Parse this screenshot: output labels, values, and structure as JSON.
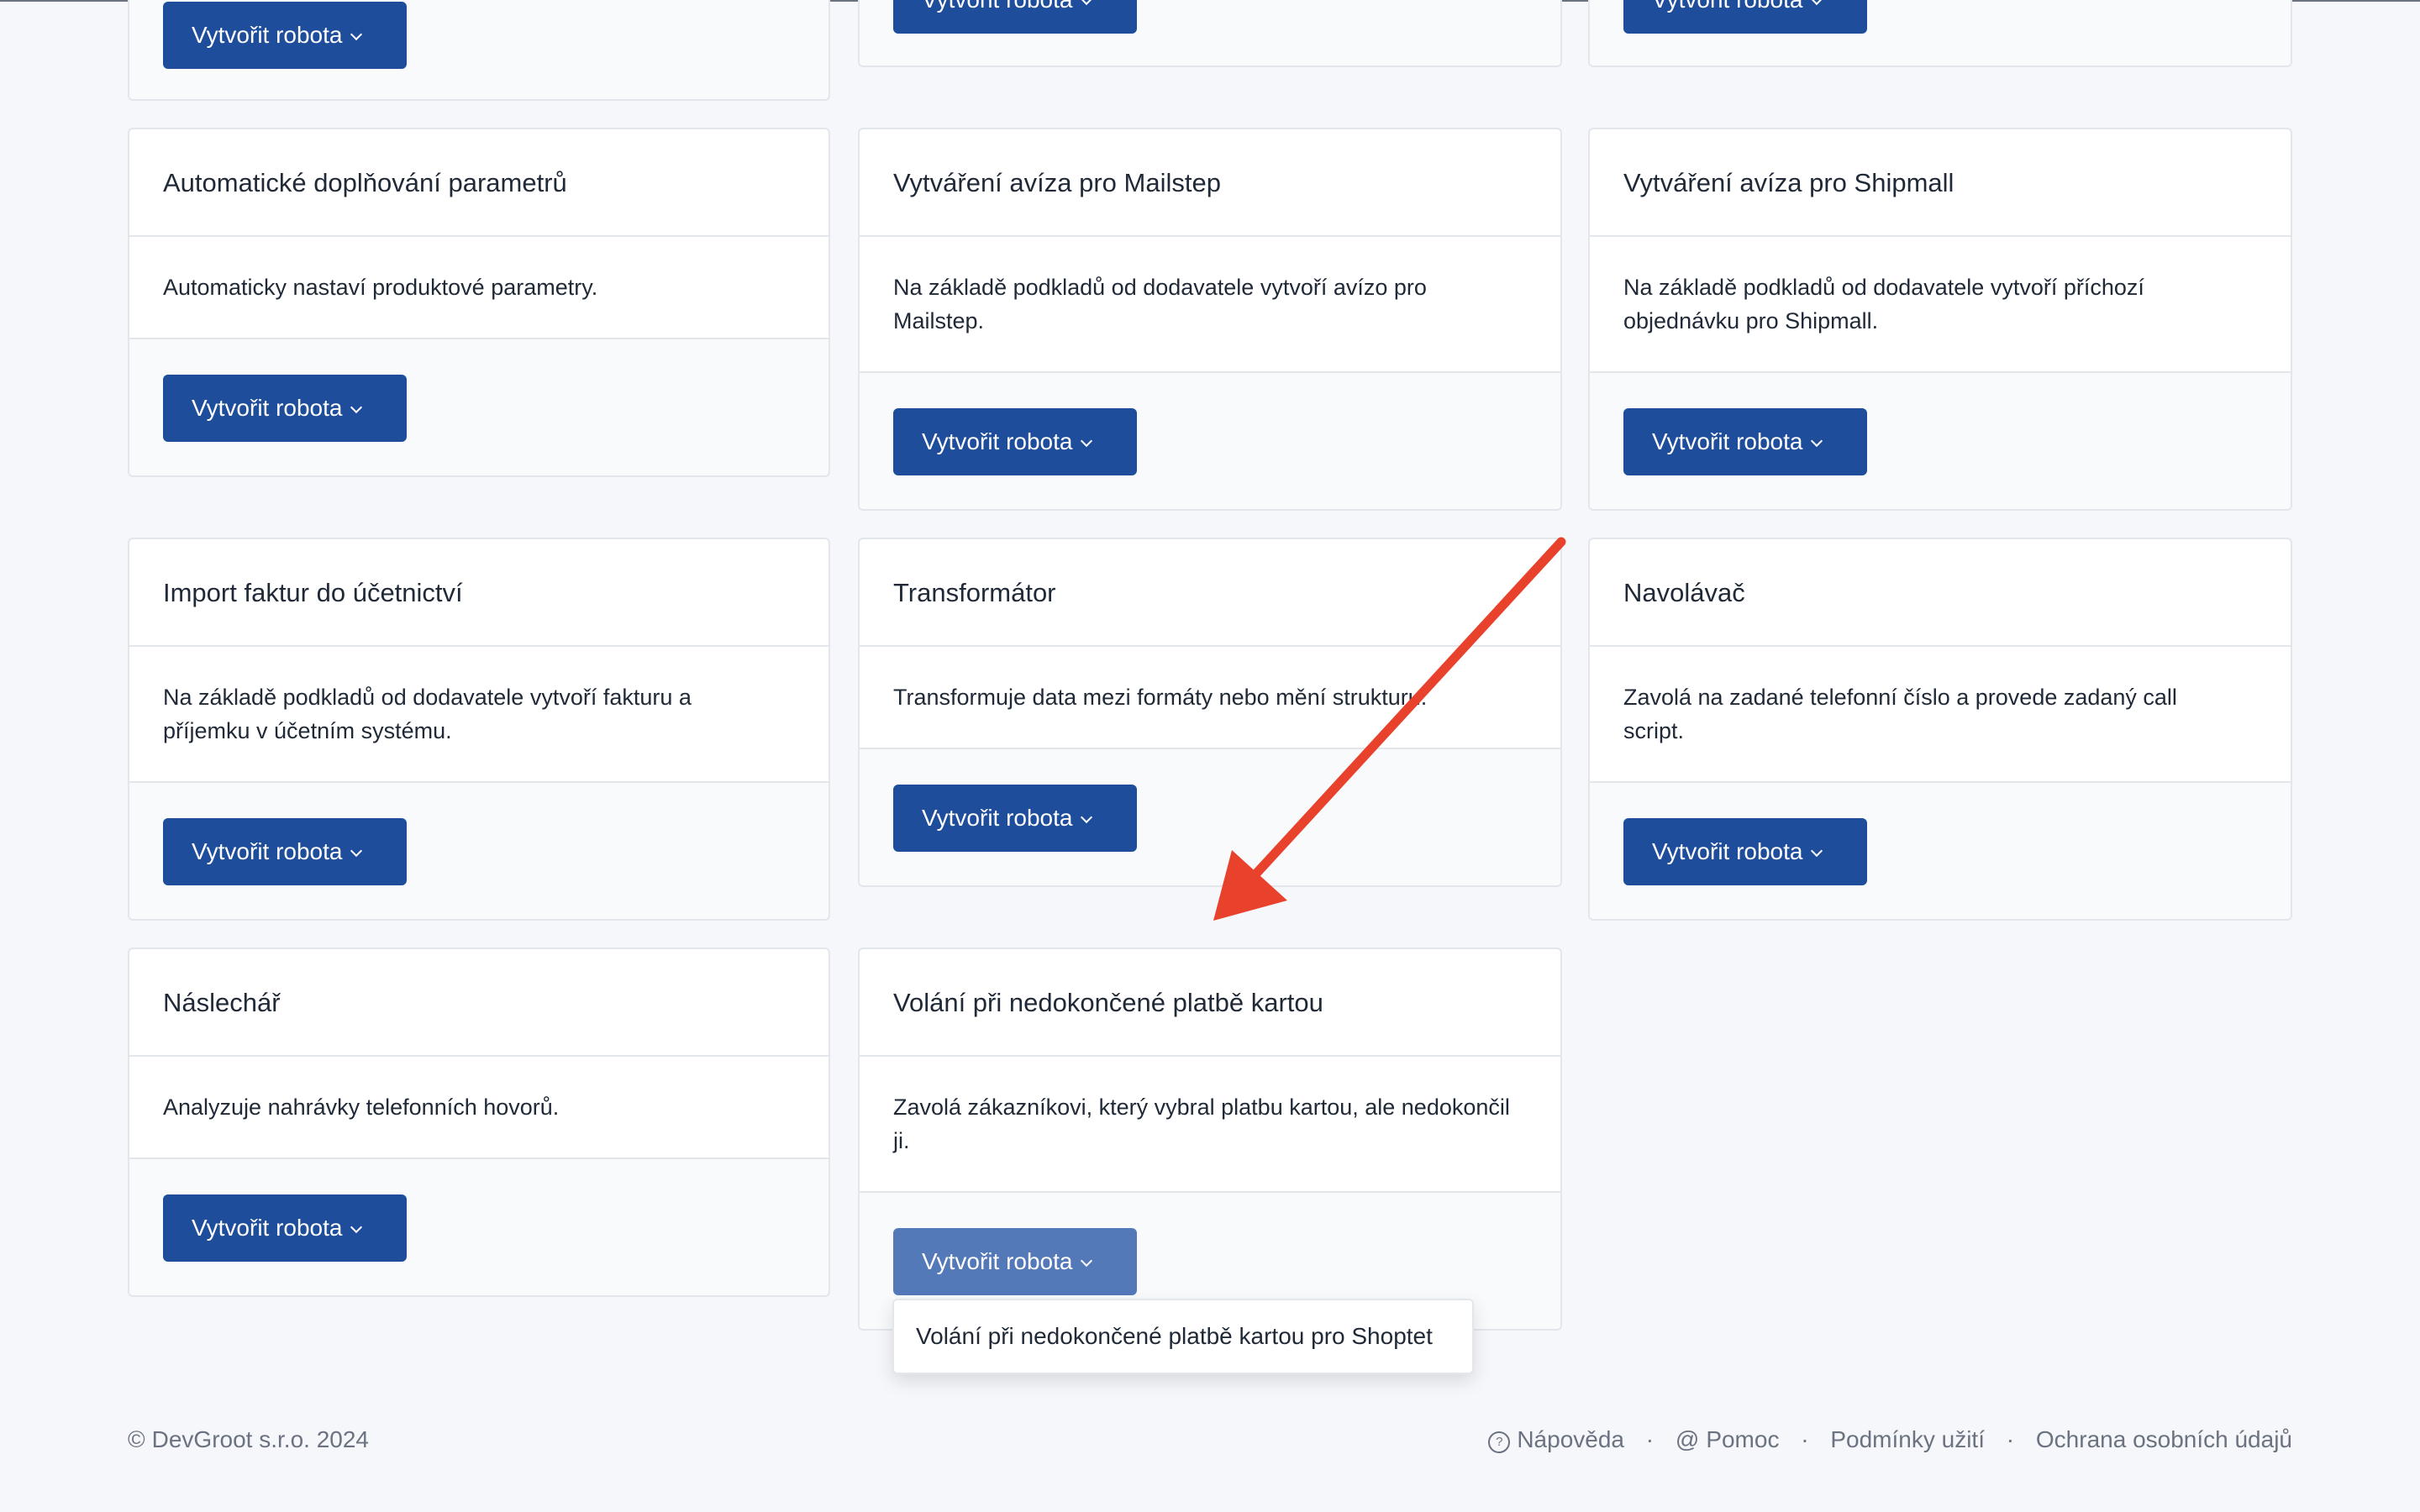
{
  "button_label": "Vytvořit robota",
  "cards": [
    {
      "title": "",
      "description": ""
    },
    {
      "title": "",
      "description": ""
    },
    {
      "title": "",
      "description": ""
    },
    {
      "title": "Automatické doplňování parametrů",
      "description": "Automaticky nastaví produktové parametry."
    },
    {
      "title": "Vytváření avíza pro Mailstep",
      "description": "Na základě podkladů od dodavatele vytvoří avízo pro Mailstep."
    },
    {
      "title": "Vytváření avíza pro Shipmall",
      "description": "Na základě podkladů od dodavatele vytvoří příchozí objednávku pro Shipmall."
    },
    {
      "title": "Import faktur do účetnictví",
      "description": "Na základě podkladů od dodavatele vytvoří fakturu a příjemku v účetním systému."
    },
    {
      "title": "Transformátor",
      "description": "Transformuje data mezi formáty nebo mění strukturu."
    },
    {
      "title": "Navolávač",
      "description": "Zavolá na zadané telefonní číslo a provede zadaný call script."
    },
    {
      "title": "Náslechář",
      "description": "Analyzuje nahrávky telefonních hovorů."
    },
    {
      "title": "Volání při nedokončené platbě kartou",
      "description": "Zavolá zákazníkovi, který vybral platbu kartou, ale nedokončil ji."
    }
  ],
  "dropdown": {
    "items": [
      "Volání při nedokončené platbě kartou pro Shoptet"
    ]
  },
  "footer": {
    "copyright": "DevGroot s.r.o. 2024",
    "copyright_symbol": "©",
    "links": [
      "Nápověda",
      "Pomoc",
      "Podmínky užití",
      "Ochrana osobních údajů"
    ],
    "separator": "·",
    "help_icon_glyph": "?",
    "at_icon_glyph": "@"
  },
  "colors": {
    "button": "#1e4d9c",
    "button_active": "#5479b9",
    "annotation_arrow": "#e8412c",
    "background": "#f6f7fb"
  },
  "icons": {
    "button_chevron": "chevron-down-icon",
    "help": "question-circle-icon",
    "support": "at-icon",
    "copyright": "copyright-icon"
  }
}
